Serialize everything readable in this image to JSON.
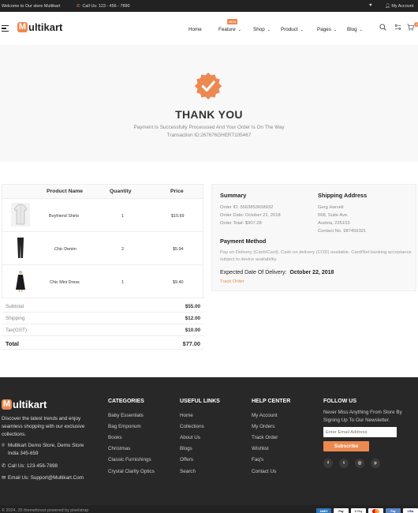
{
  "topbar": {
    "welcome": "Welcome to Our store Multikart",
    "call": "Call Us: 123 - 456 - 7890",
    "account": "My Account"
  },
  "header": {
    "logo_letter": "M",
    "logo_text": "ultikart",
    "nav": [
      "Home",
      "Feature",
      "Shop",
      "Product",
      "Pages",
      "Blog"
    ],
    "new_badge": "NEW"
  },
  "hero": {
    "title": "THANK YOU",
    "message": "Payment Is Successfully Processsed And Your Order Is On The Way",
    "transaction": "Transaction ID:267676GHERT105467"
  },
  "products": {
    "headers": [
      "Product Name",
      "Quantity",
      "Price"
    ],
    "rows": [
      {
        "name": "Boyfriend Shirts",
        "qty": "1",
        "price": "$10.69"
      },
      {
        "name": "Chic Denim",
        "qty": "2",
        "price": "$5.94"
      },
      {
        "name": "Chic Mini Dress",
        "qty": "1",
        "price": "$9.40"
      }
    ],
    "subtotal_label": "Subtotal",
    "subtotal": "$55.00",
    "shipping_label": "Shipping",
    "shipping": "$12.00",
    "tax_label": "Tax(GST)",
    "tax": "$10.00",
    "total_label": "Total",
    "total": "$77.00"
  },
  "summary": {
    "title": "Summary",
    "order_id": "Order ID: 5563853658932",
    "order_date": "Order Date: October 22, 2018",
    "order_total": "Order Total: $907.28",
    "shipping_title": "Shipping Address",
    "address": [
      "Gerg Harvell",
      "568, Suite Ave.",
      "Austria, 235153",
      "Contact No. 987456321"
    ],
    "payment_title": "Payment Method",
    "payment_text": "Pay on Delivery (Cash/Card). Cash on delivery (COD) available. Card/Net banking acceptance subject to device availability.",
    "expected_label": "Expected Date Of Delivery:",
    "expected_date": "October 22, 2018",
    "track": "Track Order"
  },
  "footer": {
    "logo_letter": "M",
    "logo_text": "ultikart",
    "description": "Discover the latest trends and enjoy seamless shopping with our exclusive collections.",
    "address_line1": "Multikart Demo Store, Demo Store",
    "address_line2": "India 345-659",
    "phone": "Call Us: 123-456-7898",
    "email": "Email Us: Support@Multikart.Com",
    "categories_title": "CATEGORIES",
    "categories": [
      "Baby Essentials",
      "Bag Emporium",
      "Books",
      "Christmas",
      "Classic Furnishings",
      "Crystal Clarity Optics"
    ],
    "useful_title": "USEFUL LINKS",
    "useful": [
      "Home",
      "Collections",
      "About Us",
      "Blogs",
      "Offers",
      "Search"
    ],
    "help_title": "HELP CENTER",
    "help": [
      "My Account",
      "My Orders",
      "Track Order",
      "Wishlist",
      "Faq's",
      "Contact Us"
    ],
    "follow_title": "FOLLOW US",
    "follow_text": "Never Miss Anything From Store By Signing Up To Our Newsletter.",
    "email_placeholder": "Enter Email Address",
    "subscribe": "Subscribe",
    "copyright": "© 2024, 25 themeforest powered by pixelstrap",
    "social_icons": [
      "facebook-icon",
      "twitter-icon",
      "instagram-icon",
      "pinterest-icon"
    ],
    "payment_icons": [
      "amex-icon",
      "apple-pay-icon",
      "google-pay-icon",
      "mastercard-icon",
      "amazon-pay-icon",
      "visa-icon"
    ]
  },
  "colors": {
    "accent": "#ec8951",
    "footer_bg": "#282828"
  }
}
